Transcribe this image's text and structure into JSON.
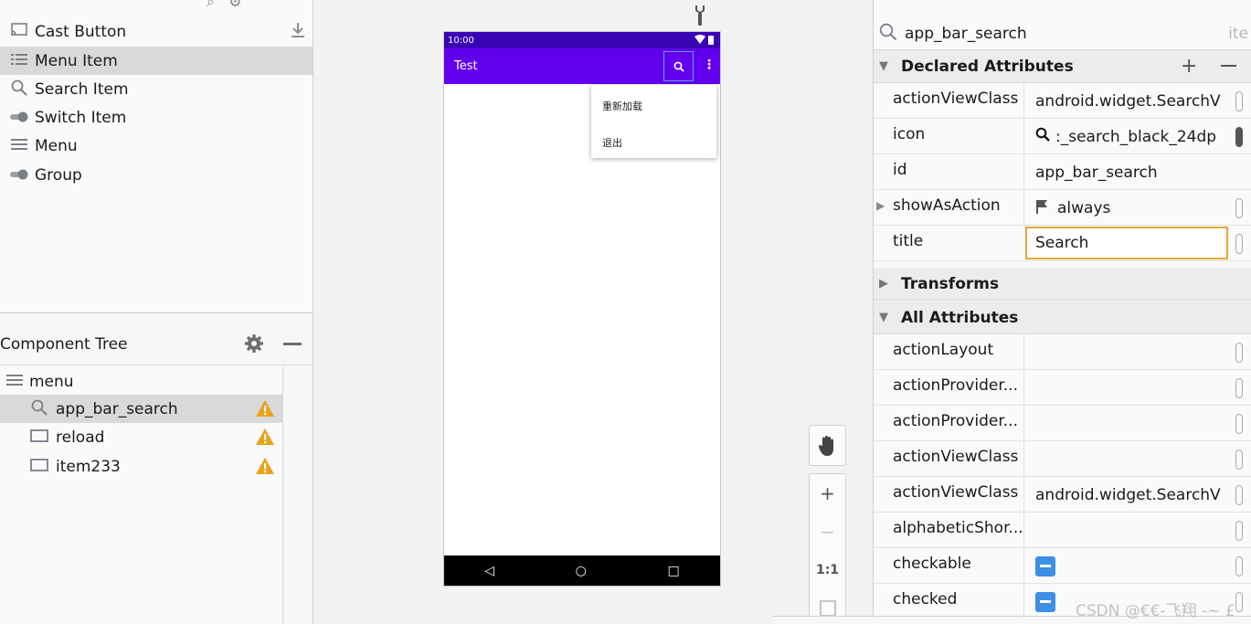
{
  "palette": {
    "items": [
      {
        "label": "Cast Button",
        "icon": "cast-icon"
      },
      {
        "label": "Menu Item",
        "icon": "list-icon"
      },
      {
        "label": "Search Item",
        "icon": "search-icon"
      },
      {
        "label": "Switch Item",
        "icon": "switch-icon"
      },
      {
        "label": "Menu",
        "icon": "menu-icon"
      },
      {
        "label": "Group",
        "icon": "group-icon"
      }
    ]
  },
  "component_tree": {
    "title": "Component Tree",
    "root": "menu",
    "children": [
      "app_bar_search",
      "reload",
      "item233"
    ]
  },
  "preview": {
    "status_time": "10:00",
    "app_title": "Test",
    "popup_items": [
      "重新加载",
      "退出"
    ]
  },
  "zoom": {
    "one_to_one": "1:1"
  },
  "attributes": {
    "search_value": "app_bar_search",
    "search_hint": "ite",
    "declared_title": "Declared Attributes",
    "declared": [
      {
        "name": "actionViewClass",
        "value": "android.widget.SearchV"
      },
      {
        "name": "icon",
        "value": ":_search_black_24dp"
      },
      {
        "name": "id",
        "value": "app_bar_search"
      },
      {
        "name": "showAsAction",
        "value": "always"
      },
      {
        "name": "title",
        "value": "Search"
      }
    ],
    "transforms_title": "Transforms",
    "all_title": "All Attributes",
    "all": [
      {
        "name": "actionLayout",
        "value": ""
      },
      {
        "name": "actionProvider...",
        "value": ""
      },
      {
        "name": "actionProvider...",
        "value": ""
      },
      {
        "name": "actionViewClass",
        "value": ""
      },
      {
        "name": "actionViewClass",
        "value": "android.widget.SearchV"
      },
      {
        "name": "alphabeticShor...",
        "value": ""
      },
      {
        "name": "checkable",
        "value": ""
      },
      {
        "name": "checked",
        "value": ""
      }
    ]
  },
  "watermark": "CSDN @€€-飞翔 -~ £",
  "colors": {
    "status_bar": "#3a04b5",
    "app_bar": "#6200ee",
    "selection": "#d9d9d9",
    "edit_outline": "#e2a93a",
    "warning": "#e8a317",
    "checkbox": "#3d8ee6"
  }
}
